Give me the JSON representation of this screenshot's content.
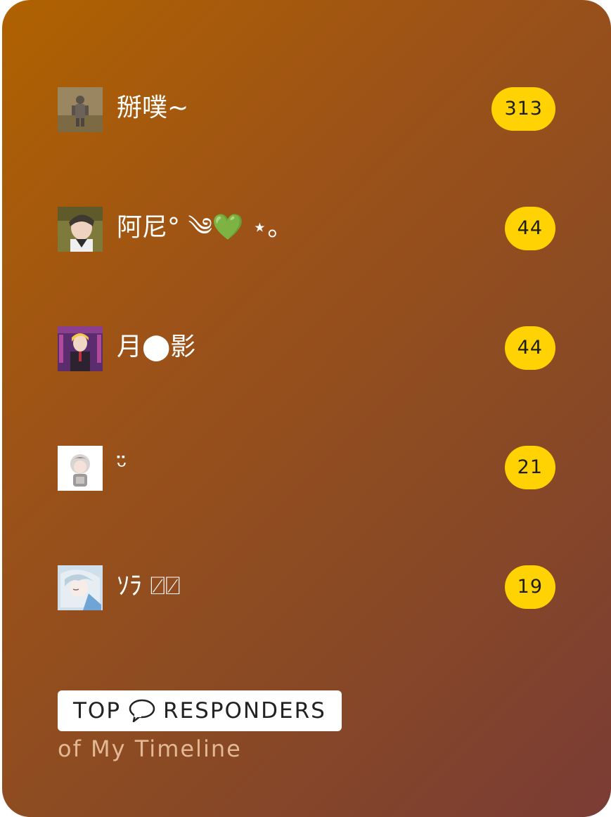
{
  "responders": [
    {
      "name": "掰噗~",
      "count": "313",
      "avatar_icon": "knight-avatar-icon"
    },
    {
      "name": "阿尼° ༄💚 ⋆｡",
      "count": "44",
      "avatar_icon": "anime-boy-avatar-icon"
    },
    {
      "name": "月⬤影",
      "count": "44",
      "avatar_icon": "blonde-character-avatar-icon"
    },
    {
      "name": "ᵕ̈",
      "count": "21",
      "avatar_icon": "chibi-girl-avatar-icon"
    },
    {
      "name": "ｿﾗ ⍁⍁",
      "count": "19",
      "avatar_icon": "silver-hair-avatar-icon"
    }
  ],
  "footer": {
    "title_left": "TOP",
    "title_right": "RESPONDERS",
    "subtitle": "of My Timeline",
    "bubble_icon": "speech-bubble-icon"
  },
  "colors": {
    "gradient_start": "#b06200",
    "gradient_end": "#7a3c35",
    "badge": "#ffd203"
  }
}
